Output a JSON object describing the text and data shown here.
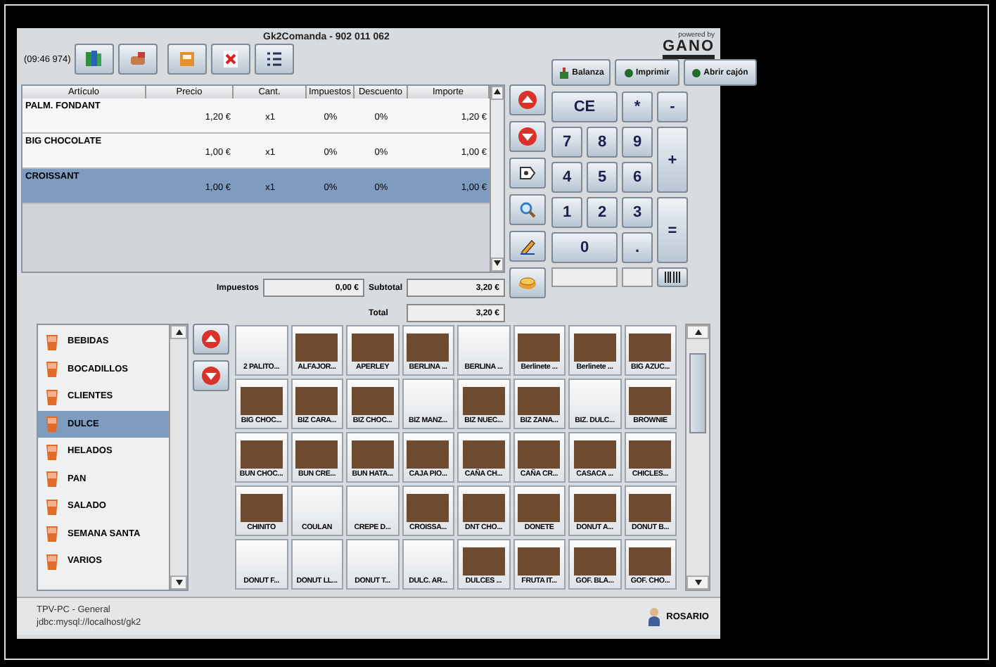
{
  "window": {
    "title": "Gk2Comanda - 902 011 062",
    "powered_by": "powered by",
    "logo": "GANO"
  },
  "toolbar": {
    "display": "(09:46 974)",
    "actions": [
      "Balanza",
      "Imprimir",
      "Abrir cajón"
    ]
  },
  "ticket": {
    "columns": [
      "Artículo",
      "Precio",
      "Cant.",
      "Impuestos",
      "Descuento",
      "Importe"
    ],
    "rows": [
      {
        "cells": [
          "PALM. FONDANT",
          "1,20 €",
          "x1",
          "0%",
          "0%",
          "1,20 €"
        ],
        "selected": false
      },
      {
        "cells": [
          "BIG CHOCOLATE",
          "1,00 €",
          "x1",
          "0%",
          "0%",
          "1,00 €"
        ],
        "selected": false
      },
      {
        "cells": [
          "CROISSANT",
          "1,00 €",
          "x1",
          "0%",
          "0%",
          "1,00 €"
        ],
        "selected": true
      }
    ]
  },
  "totals": [
    {
      "label": "Impuestos",
      "value": "0,00 €"
    },
    {
      "label": "Subtotal",
      "value": "3,20 €"
    },
    {
      "label": "Total",
      "value": "3,20 €"
    }
  ],
  "keypad": [
    "CE",
    "*",
    "-",
    "7",
    "8",
    "9",
    "+",
    "4",
    "5",
    "6",
    "1",
    "2",
    "3",
    "=",
    "0",
    "."
  ],
  "categories": [
    {
      "label": "BEBIDAS",
      "selected": false
    },
    {
      "label": "BOCADILLOS",
      "selected": false
    },
    {
      "label": "CLIENTES",
      "selected": false
    },
    {
      "label": "DULCE",
      "selected": true
    },
    {
      "label": "HELADOS",
      "selected": false
    },
    {
      "label": "PAN",
      "selected": false
    },
    {
      "label": "SALADO",
      "selected": false
    },
    {
      "label": "SEMANA SANTA",
      "selected": false
    },
    {
      "label": "VARIOS",
      "selected": false
    }
  ],
  "products": [
    {
      "label": "2 PALITO...",
      "photo": false
    },
    {
      "label": "ALFAJOR...",
      "photo": true
    },
    {
      "label": "APERLEY",
      "photo": true
    },
    {
      "label": "BERLINA ...",
      "photo": true
    },
    {
      "label": "BERLINA ...",
      "photo": false
    },
    {
      "label": "Berlinete ...",
      "photo": true
    },
    {
      "label": "Berlinete ...",
      "photo": true
    },
    {
      "label": "BIG AZUC...",
      "photo": true
    },
    {
      "label": "BIG CHOC...",
      "photo": true
    },
    {
      "label": "BIZ CARA...",
      "photo": true
    },
    {
      "label": "BIZ CHOC...",
      "photo": true
    },
    {
      "label": "BIZ MANZ...",
      "photo": false
    },
    {
      "label": "BIZ NUEC...",
      "photo": true
    },
    {
      "label": "BIZ ZANA...",
      "photo": true
    },
    {
      "label": "BIZ. DULC...",
      "photo": false
    },
    {
      "label": "BROWNIE",
      "photo": true
    },
    {
      "label": "BUN CHOC...",
      "photo": true
    },
    {
      "label": "BUN CRE...",
      "photo": true
    },
    {
      "label": "BUN HATA...",
      "photo": true
    },
    {
      "label": "CAJA PIO...",
      "photo": true
    },
    {
      "label": "CAÑA CH...",
      "photo": true
    },
    {
      "label": "CAÑA CR...",
      "photo": true
    },
    {
      "label": "CASACA ...",
      "photo": true
    },
    {
      "label": "CHICLES...",
      "photo": true
    },
    {
      "label": "CHINITO",
      "photo": true
    },
    {
      "label": "COULAN",
      "photo": false
    },
    {
      "label": "CREPE D...",
      "photo": false
    },
    {
      "label": "CROISSA...",
      "photo": true
    },
    {
      "label": "DNT CHO...",
      "photo": true
    },
    {
      "label": "DONETE",
      "photo": true
    },
    {
      "label": "DONUT A...",
      "photo": true
    },
    {
      "label": "DONUT B...",
      "photo": true
    },
    {
      "label": "DONUT F...",
      "photo": false
    },
    {
      "label": "DONUT LL...",
      "photo": false
    },
    {
      "label": "DONUT T...",
      "photo": false
    },
    {
      "label": "DULC. AR...",
      "photo": false
    },
    {
      "label": "DULCES ...",
      "photo": true
    },
    {
      "label": "FRUTA IT...",
      "photo": true
    },
    {
      "label": "GOF. BLA...",
      "photo": true
    },
    {
      "label": "GOF. CHO...",
      "photo": true
    }
  ],
  "status_bar": {
    "terminal": "TPV-PC - General",
    "connection": "jdbc:mysql://localhost/gk2",
    "user": "ROSARIO"
  }
}
